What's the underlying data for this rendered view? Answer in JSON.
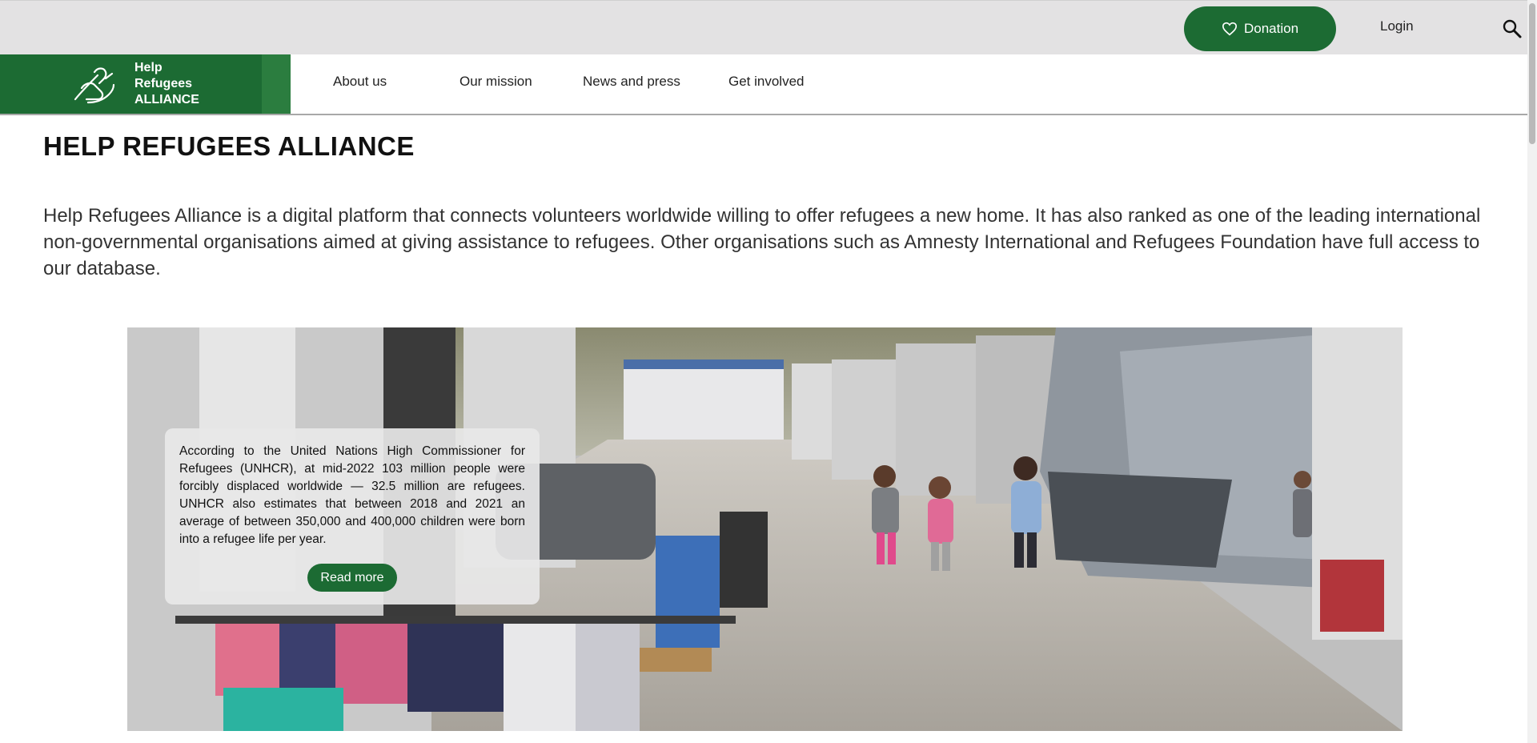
{
  "topbar": {
    "donate_label": "Donation",
    "login_label": "Login"
  },
  "logo": {
    "line1": "Help",
    "line2": "Refugees",
    "line3": "ALLIANCE"
  },
  "nav": {
    "items": [
      {
        "label": "About us"
      },
      {
        "label": "Our mission"
      },
      {
        "label": "News and press"
      },
      {
        "label": "Get involved"
      }
    ]
  },
  "main": {
    "title": "HELP REFUGEES ALLIANCE",
    "intro": "Help Refugees Alliance is a digital platform that connects volunteers worldwide willing to offer refugees a new home. It has also ranked as one of the leading international non-governmental organisations aimed at giving assistance to refugees. Other organisations such as Amnesty International and Refugees Foundation have full access to our database."
  },
  "hero": {
    "card_text": "According to the United Nations High Commissioner for Refugees (UNHCR), at mid-2022 103 million people were forcibly displaced worldwide — 32.5 million are refugees. UNHCR also estimates that between 2018 and 2021 an average of between 350,000 and 400,000 children were born into a refugee life per year.",
    "read_more_label": "Read more"
  },
  "colors": {
    "brand_green": "#1c6b33",
    "topbar_bg": "#e3e2e3"
  },
  "icons": {
    "donate": "heart-icon",
    "search": "search-icon",
    "logo": "hands-heart-logo-icon"
  }
}
